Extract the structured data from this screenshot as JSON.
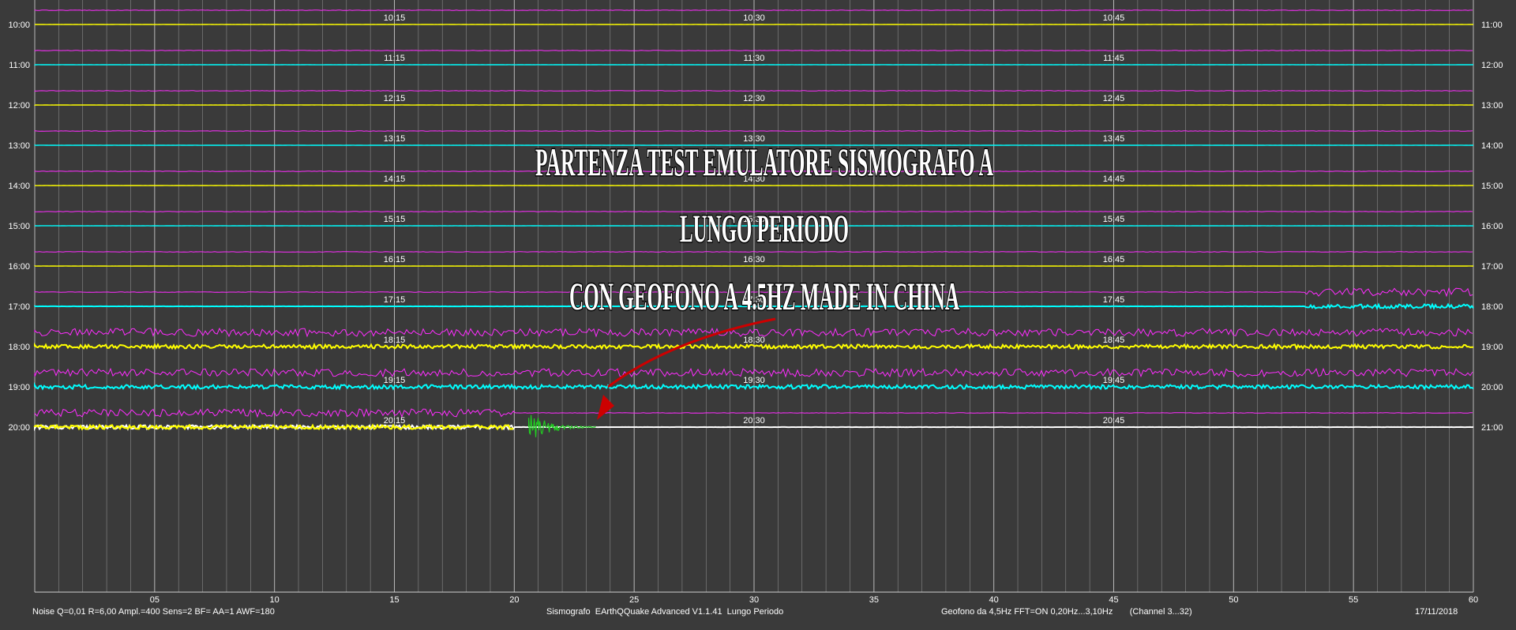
{
  "colors": {
    "background": "#3a3a3a",
    "grid": "#8a8a8a",
    "axis_text": "#ffffff",
    "yellow_trace": "#ffff00",
    "cyan_trace": "#00ffff",
    "magenta_trace": "#ff2dff",
    "event_trace": "#22cc22",
    "annotation_text": "#ffffff",
    "arrow": "#cc0000"
  },
  "left_hour_labels": [
    "10:00",
    "11:00",
    "12:00",
    "13:00",
    "14:00",
    "15:00",
    "16:00",
    "17:00",
    "18:00",
    "19:00",
    "20:00"
  ],
  "right_hour_labels": [
    "11:00",
    "12:00",
    "13:00",
    "14:00",
    "15:00",
    "16:00",
    "17:00",
    "18:00",
    "19:00",
    "20:00",
    "21:00"
  ],
  "row_colors": [
    "yellow",
    "cyan",
    "yellow",
    "cyan",
    "yellow",
    "cyan",
    "yellow",
    "cyan",
    "yellow",
    "cyan",
    "yellow"
  ],
  "quarter_labels": [
    [
      "10:15",
      "10:30",
      "10:45"
    ],
    [
      "11:15",
      "11:30",
      "11:45"
    ],
    [
      "12:15",
      "12:30",
      "12:45"
    ],
    [
      "13:15",
      "13:30",
      "13:45"
    ],
    [
      "14:15",
      "14:30",
      "14:45"
    ],
    [
      "15:15",
      "15:30",
      "15:45"
    ],
    [
      "16:15",
      "16:30",
      "16:45"
    ],
    [
      "17:15",
      "17:30",
      "17:45"
    ],
    [
      "18:15",
      "18:30",
      "18:45"
    ],
    [
      "19:15",
      "19:30",
      "19:45"
    ],
    [
      "20:15",
      "20:30",
      "20:45"
    ]
  ],
  "minute_ticks": [
    "05",
    "10",
    "15",
    "20",
    "25",
    "30",
    "35",
    "40",
    "45",
    "50",
    "55",
    "60"
  ],
  "minute_range": [
    0,
    60
  ],
  "row_activity": [
    {
      "start": 0,
      "end": 60,
      "level": 0
    },
    {
      "start": 0,
      "end": 60,
      "level": 0
    },
    {
      "start": 0,
      "end": 60,
      "level": 0
    },
    {
      "start": 0,
      "end": 60,
      "level": 0
    },
    {
      "start": 0,
      "end": 60,
      "level": 0
    },
    {
      "start": 0,
      "end": 60,
      "level": 0
    },
    {
      "start": 0,
      "end": 60,
      "level": 0
    },
    {
      "start": 53,
      "end": 60,
      "level": 1
    },
    {
      "start": 0,
      "end": 60,
      "level": 1
    },
    {
      "start": 0,
      "end": 60,
      "level": 1
    },
    {
      "start": 0,
      "end": 20,
      "level": 1
    }
  ],
  "event": {
    "row": 10,
    "start_minute": 20.6,
    "end_minute": 23.4
  },
  "footer": {
    "noise": "Noise Q=0,01 R=6,00 Ampl.=400 Sens=2 BF= AA=1 AWF=180",
    "program": "Sismografo  EArthQQuake Advanced V1.1.41  Lungo Periodo",
    "sensor": "Geofono da 4,5Hz FFT=ON 0,20Hz...3,10Hz       (Channel 3...32)",
    "date": "17/11/2018"
  },
  "annotation": {
    "line1": "PARTENZA TEST EMULATORE SISMOGRAFO A",
    "line2": "LUNGO PERIODO",
    "line3": "CON GEOFONO A 4.5HZ MADE IN CHINA"
  }
}
